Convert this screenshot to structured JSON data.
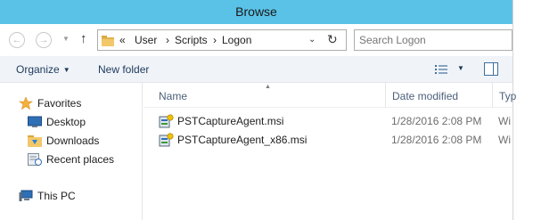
{
  "window": {
    "title": "Browse"
  },
  "address": {
    "crumbs": [
      "«",
      "User",
      "Scripts",
      "Logon"
    ],
    "separators": [
      "›",
      "›"
    ]
  },
  "search": {
    "placeholder": "Search Logon"
  },
  "toolbar": {
    "organize": "Organize",
    "new_folder": "New folder"
  },
  "sidebar": {
    "favorites": "Favorites",
    "items": [
      {
        "label": "Desktop",
        "icon": "desktop-icon"
      },
      {
        "label": "Downloads",
        "icon": "downloads-folder-icon"
      },
      {
        "label": "Recent places",
        "icon": "recent-places-icon"
      }
    ],
    "this_pc": "This PC"
  },
  "columns": {
    "name": "Name",
    "date": "Date modified",
    "type": "Typ"
  },
  "files": [
    {
      "name": "PSTCaptureAgent.msi",
      "date": "1/28/2016 2:08 PM",
      "type": "Wi",
      "icon": "msi-package-icon"
    },
    {
      "name": "PSTCaptureAgent_x86.msi",
      "date": "1/28/2016 2:08 PM",
      "type": "Wi",
      "icon": "msi-package-icon"
    }
  ],
  "colors": {
    "titlebar": "#5bc2e7",
    "toolbar_bg": "#f0f4f9",
    "header_text": "#4c607a",
    "link_text": "#1e395b"
  }
}
